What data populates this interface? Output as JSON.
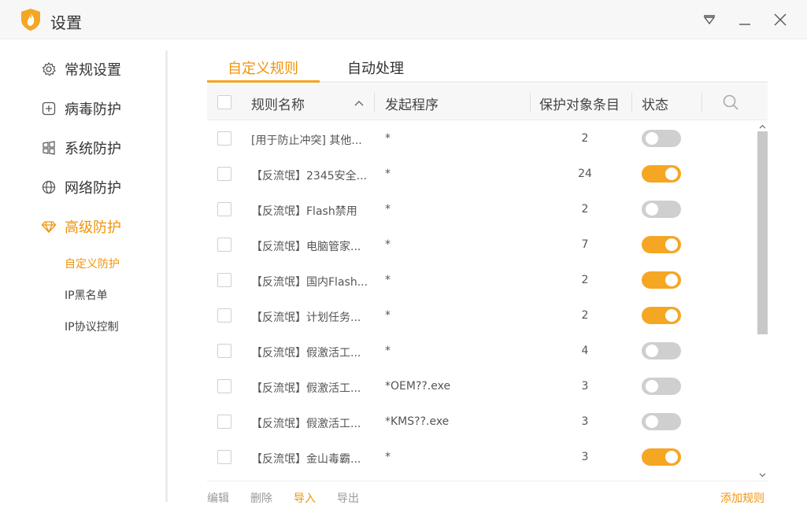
{
  "window": {
    "title": "设置",
    "buttons": [
      "menu-dropdown",
      "minimize",
      "close"
    ]
  },
  "sidebar": {
    "items": [
      {
        "label": "常规设置",
        "icon": "gear-icon"
      },
      {
        "label": "病毒防护",
        "icon": "plus-square-icon"
      },
      {
        "label": "系统防护",
        "icon": "windows-icon"
      },
      {
        "label": "网络防护",
        "icon": "globe-icon"
      },
      {
        "label": "高级防护",
        "icon": "diamond-icon",
        "active": true
      }
    ],
    "subitems": [
      {
        "label": "自定义防护",
        "active": true
      },
      {
        "label": "IP黑名单"
      },
      {
        "label": "IP协议控制"
      }
    ]
  },
  "tabs": [
    {
      "label": "自定义规则",
      "active": true
    },
    {
      "label": "自动处理"
    }
  ],
  "table": {
    "headers": {
      "name": "规则名称",
      "program": "发起程序",
      "count": "保护对象条目",
      "status": "状态"
    },
    "rows": [
      {
        "name": "[用于防止冲突] 其他...",
        "program": "*",
        "count": "2",
        "enabled": false
      },
      {
        "name": "【反流氓】2345安全...",
        "program": "*",
        "count": "24",
        "enabled": true
      },
      {
        "name": "【反流氓】Flash禁用",
        "program": "*",
        "count": "2",
        "enabled": false
      },
      {
        "name": "【反流氓】电脑管家...",
        "program": "*",
        "count": "7",
        "enabled": true
      },
      {
        "name": "【反流氓】国内Flash...",
        "program": "*",
        "count": "2",
        "enabled": true
      },
      {
        "name": "【反流氓】计划任务...",
        "program": "*",
        "count": "2",
        "enabled": true
      },
      {
        "name": "【反流氓】假激活工...",
        "program": "*",
        "count": "4",
        "enabled": false
      },
      {
        "name": "【反流氓】假激活工...",
        "program": "*OEM??.exe",
        "count": "3",
        "enabled": false
      },
      {
        "name": "【反流氓】假激活工...",
        "program": "*KMS??.exe",
        "count": "3",
        "enabled": false
      },
      {
        "name": "【反流氓】金山毒霸...",
        "program": "*",
        "count": "3",
        "enabled": true
      }
    ]
  },
  "footer": {
    "edit": "编辑",
    "delete": "删除",
    "import": "导入",
    "export": "导出",
    "add": "添加规则"
  },
  "colors": {
    "accent": "#f5a623",
    "accent_text": "#f0940a",
    "toggle_off": "#cfcfcf"
  }
}
